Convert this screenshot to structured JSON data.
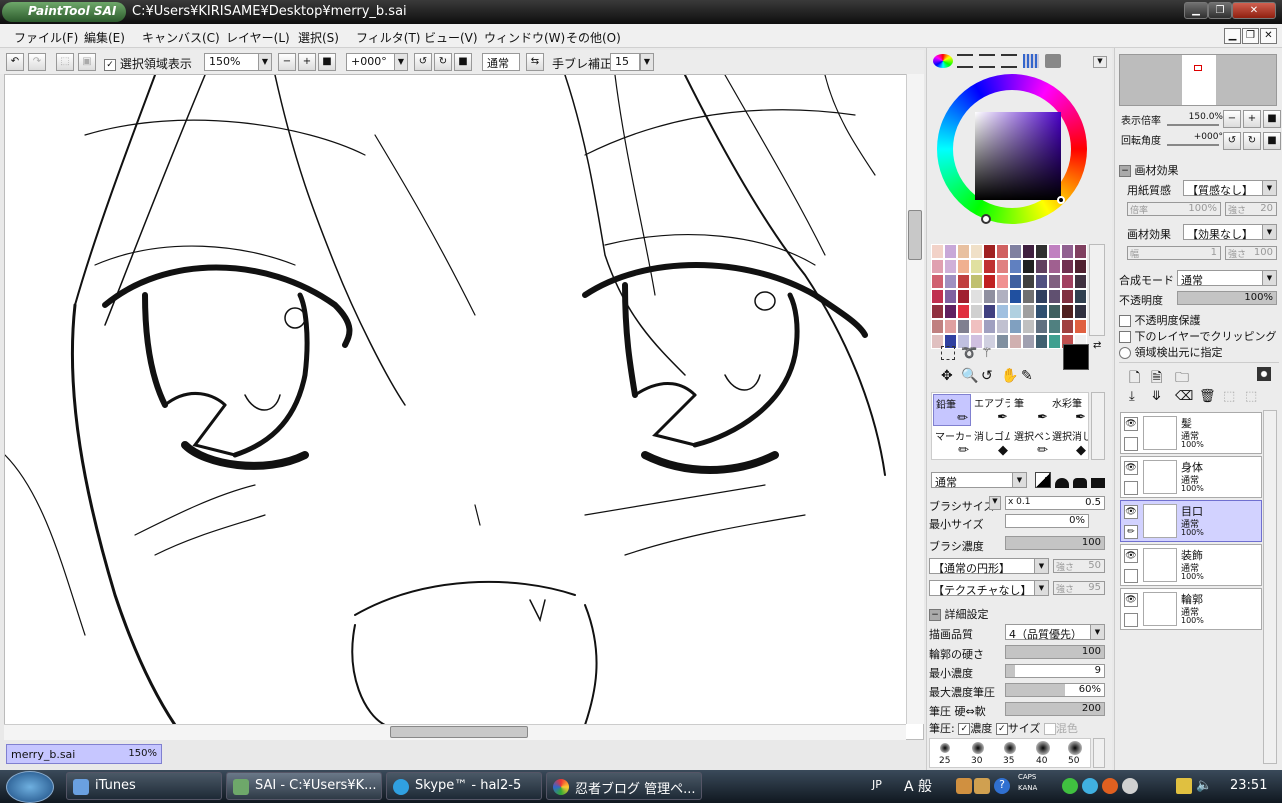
{
  "window": {
    "app_logo": "PaintTool SAI",
    "title": "C:¥Users¥KIRISAME¥Desktop¥merry_b.sai"
  },
  "menu": [
    "ファイル(F)",
    "編集(E)",
    "キャンバス(C)",
    "レイヤー(L)",
    "選択(S)",
    "フィルタ(T)",
    "ビュー(V)",
    "ウィンドウ(W)",
    "その他(O)"
  ],
  "toolbar": {
    "show_selection_label": "選択領域表示",
    "zoom_value": "150%",
    "rotation_value": "+000°",
    "blend_mode": "通常",
    "stabilizer_label": "手ブレ補正",
    "stabilizer_value": "15"
  },
  "canvas_tab": {
    "name": "merry_b.sai",
    "zoom": "150%"
  },
  "navigator": {
    "zoom_label": "表示倍率",
    "zoom_value": "150.0%",
    "rotate_label": "回転角度",
    "rotate_value": "+000°"
  },
  "material": {
    "header": "画材効果",
    "paper_label": "用紙質感",
    "paper_value": "【質感なし】",
    "paper_scale_label": "倍率",
    "paper_scale_value": "100%",
    "paper_strength_label": "強さ",
    "paper_strength_value": "20",
    "effect_label": "画材効果",
    "effect_value": "【効果なし】",
    "effect_width_label": "幅",
    "effect_width_value": "1",
    "effect_strength_label": "強さ",
    "effect_strength_value": "100"
  },
  "layer_props": {
    "blend_label": "合成モード",
    "blend_value": "通常",
    "opacity_label": "不透明度",
    "opacity_value": "100%",
    "opacity_fill": 1.0,
    "protect_label": "不透明度保護",
    "clip_label": "下のレイヤーでクリッピング",
    "source_label": "領域検出元に指定"
  },
  "layers": [
    {
      "name": "髪",
      "mode": "通常",
      "opacity": "100%",
      "selected": false
    },
    {
      "name": "身体",
      "mode": "通常",
      "opacity": "100%",
      "selected": false
    },
    {
      "name": "目口",
      "mode": "通常",
      "opacity": "100%",
      "selected": true
    },
    {
      "name": "装飾",
      "mode": "通常",
      "opacity": "100%",
      "selected": false
    },
    {
      "name": "輪郭",
      "mode": "通常",
      "opacity": "100%",
      "selected": false
    }
  ],
  "tools": [
    {
      "label": "鉛筆",
      "selected": true
    },
    {
      "label": "エアブラシ",
      "selected": false
    },
    {
      "label": "筆",
      "selected": false
    },
    {
      "label": "水彩筆",
      "selected": false
    },
    {
      "label": "マーカー",
      "selected": false
    },
    {
      "label": "消しゴム",
      "selected": false
    },
    {
      "label": "選択ペン",
      "selected": false
    },
    {
      "label": "選択消し",
      "selected": false
    }
  ],
  "brush": {
    "mode": "通常",
    "size_label": "ブラシサイズ",
    "size_mult": "x 0.1",
    "size_value": "0.5",
    "min_size_label": "最小サイズ",
    "min_size_value": "0%",
    "density_label": "ブラシ濃度",
    "density_value": "100",
    "shape_value": "【通常の円形】",
    "shape_strength_label": "強さ",
    "shape_strength_value": "50",
    "texture_value": "【テクスチャなし】",
    "texture_strength_label": "強さ",
    "texture_strength_value": "95",
    "detail_header": "詳細設定",
    "quality_label": "描画品質",
    "quality_value": "4（品質優先）",
    "edge_label": "輪郭の硬さ",
    "edge_value": "100",
    "edge_fill": 1.0,
    "min_density_label": "最小濃度",
    "min_density_value": "9",
    "min_density_fill": 0.09,
    "max_pressure_label": "最大濃度筆圧",
    "max_pressure_value": "60%",
    "max_pressure_fill": 0.6,
    "pressure_label": "筆圧 硬⇔軟",
    "pressure_value": "200",
    "pressure_fill": 1.0,
    "pressure_row_label": "筆圧:",
    "pressure_density": "濃度",
    "pressure_size": "サイズ",
    "pressure_mix": "混色",
    "sizes": [
      "25",
      "30",
      "35",
      "40",
      "50"
    ]
  },
  "swatches": [
    "#f2d2c8",
    "#c8a8d8",
    "#e8c0a0",
    "#f0e0c8",
    "#a02020",
    "#d06060",
    "#8080a0",
    "#402040",
    "#303030",
    "#c080c0",
    "#906090",
    "#804060",
    "#e0a0b0",
    "#d0b0d8",
    "#f0b090",
    "#e0e0a0",
    "#c03030",
    "#e08080",
    "#6080c0",
    "#202020",
    "#604060",
    "#a06090",
    "#703050",
    "#502030",
    "#d06070",
    "#a090c0",
    "#c04040",
    "#c0c070",
    "#c02020",
    "#f09090",
    "#4060a0",
    "#404040",
    "#505080",
    "#806080",
    "#a04060",
    "#403040",
    "#c03050",
    "#8060a0",
    "#a02030",
    "#e0e0e0",
    "#9090a0",
    "#b0b0c0",
    "#2050a0",
    "#707070",
    "#304060",
    "#605070",
    "#803040",
    "#304050",
    "#903040",
    "#602060",
    "#e03040",
    "#d0d0d0",
    "#404080",
    "#a0c0e0",
    "#b0d0e0",
    "#a0a0a0",
    "#305070",
    "#406060",
    "#502020",
    "#303040",
    "#c08080",
    "#e0a0a0",
    "#808090",
    "#f0c0c0",
    "#a0a0c0",
    "#c0c0d0",
    "#80a0c0",
    "#c0c0c0",
    "#607080",
    "#508080",
    "#a04040",
    "#e06040",
    "#e0c0c0",
    "#3040a0",
    "#c0c0e0",
    "#d0c0e0",
    "#d0d0e0",
    "#8090a0",
    "#d0b0b0",
    "#a0a0b0",
    "#406070",
    "#40a090",
    "#c05050",
    "#f0f0f0"
  ],
  "colors": {
    "fg": "#000000",
    "bg": "#ffffff",
    "accent": "#c6c6ff"
  },
  "taskbar": {
    "items": [
      "iTunes",
      "SAI - C:¥Users¥K...",
      "Skype™ - hal2-5",
      "忍者ブログ 管理ペ..."
    ],
    "lang": "JP",
    "ime": "A 般",
    "caps": "CAPS",
    "kana": "KANA",
    "time": "23:51"
  }
}
